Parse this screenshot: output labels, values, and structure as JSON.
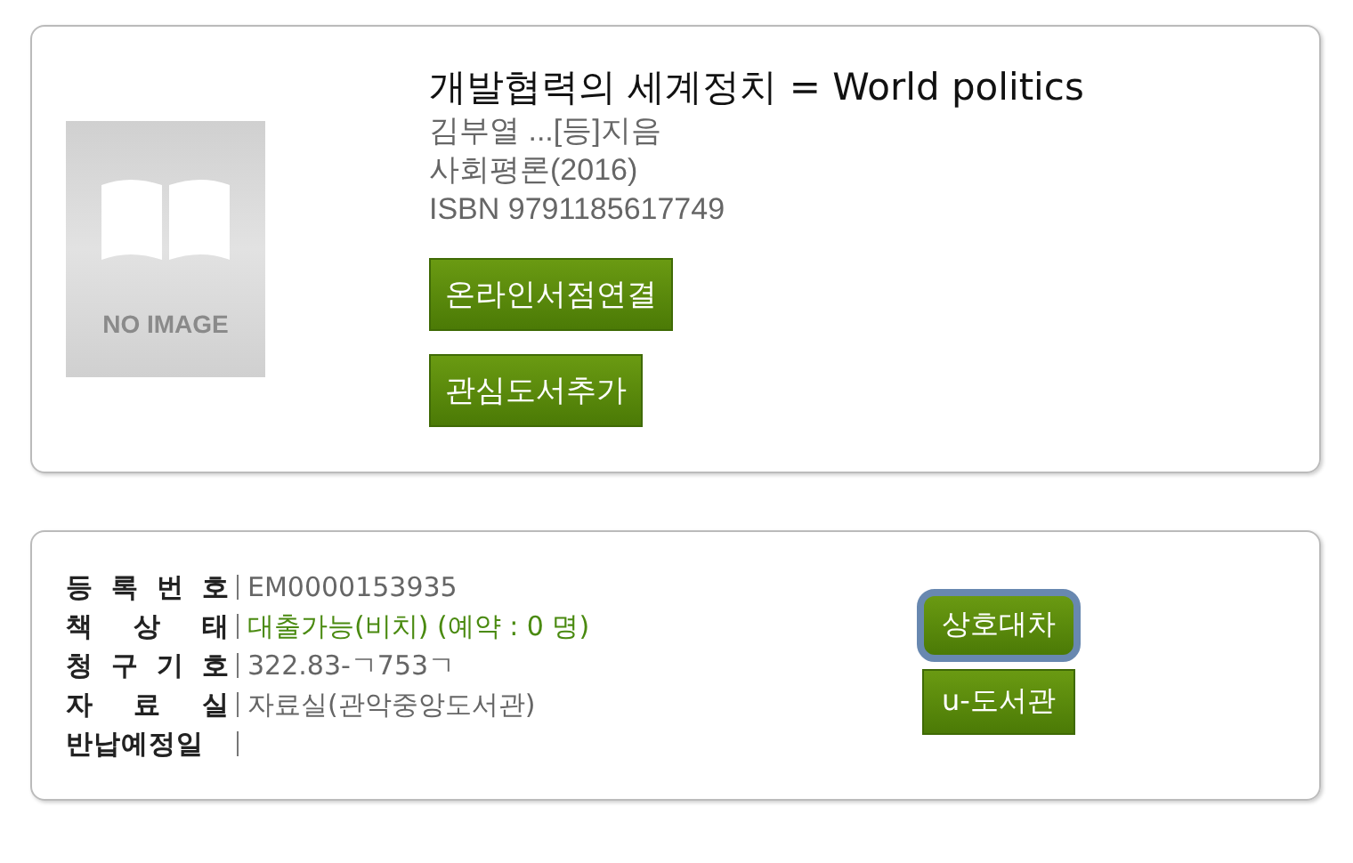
{
  "book": {
    "cover": {
      "kind": "placeholder",
      "text": "NO IMAGE"
    },
    "title": "개발협력의 세계정치 = World politics",
    "author": "김부열 ...[등]지음",
    "publisher": "사회평론(2016)",
    "isbn": "ISBN 9791185617749",
    "buttons": [
      {
        "label": "온라인서점연결"
      },
      {
        "label": "관심도서추가"
      }
    ]
  },
  "holding": {
    "fields": [
      {
        "label": "등 록 번 호",
        "value": "EM0000153935",
        "kind": "plain"
      },
      {
        "label": "책 상 태",
        "value": "대출가능(비치) (예약 : 0 명)",
        "kind": "status"
      },
      {
        "label": "청 구 기 호",
        "value": "322.83-ㄱ753ㄱ",
        "kind": "plain"
      },
      {
        "label": "자 료 실",
        "value": "자료실(관악중앙도서관)",
        "kind": "plain"
      },
      {
        "label": "반납예정일"
      }
    ],
    "buttons": [
      {
        "label": "상호대차",
        "focused": true
      },
      {
        "label": "u-도서관",
        "focused": false
      }
    ]
  }
}
